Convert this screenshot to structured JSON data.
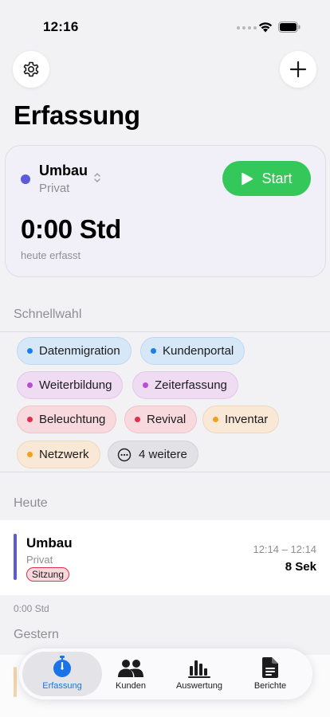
{
  "status": {
    "time": "12:16"
  },
  "header": {
    "title": "Erfassung"
  },
  "tracker": {
    "project": "Umbau",
    "client": "Privat",
    "project_color": "#5b5bd6",
    "start_label": "Start",
    "duration": "0:00 Std",
    "duration_caption": "heute erfasst"
  },
  "quick": {
    "header": "Schnellwahl",
    "chips": [
      {
        "label": "Datenmigration",
        "color": "#1a7cf0"
      },
      {
        "label": "Kundenportal",
        "color": "#1a7cf0"
      },
      {
        "label": "Weiterbildung",
        "color": "#b550d6"
      },
      {
        "label": "Zeiterfassung",
        "color": "#b550d6"
      },
      {
        "label": "Beleuchtung",
        "color": "#e0304c"
      },
      {
        "label": "Revival",
        "color": "#e0304c"
      },
      {
        "label": "Inventar",
        "color": "#f2a11f"
      },
      {
        "label": "Netzwerk",
        "color": "#f2a11f"
      }
    ],
    "more_label": "4 weitere"
  },
  "today": {
    "header": "Heute",
    "entry": {
      "project": "Umbau",
      "client": "Privat",
      "tag": "Sitzung",
      "time_range": "12:14 – 12:14",
      "duration": "8 Sek"
    },
    "total": "0:00 Std"
  },
  "yesterday": {
    "header": "Gestern"
  },
  "tabs": [
    {
      "label": "Erfassung",
      "icon": "stopwatch-icon",
      "active": true
    },
    {
      "label": "Kunden",
      "icon": "people-icon"
    },
    {
      "label": "Auswertung",
      "icon": "chart-icon"
    },
    {
      "label": "Berichte",
      "icon": "document-icon"
    }
  ],
  "colors": {
    "accent": "#34c759",
    "tab_active": "#1a73e8"
  }
}
